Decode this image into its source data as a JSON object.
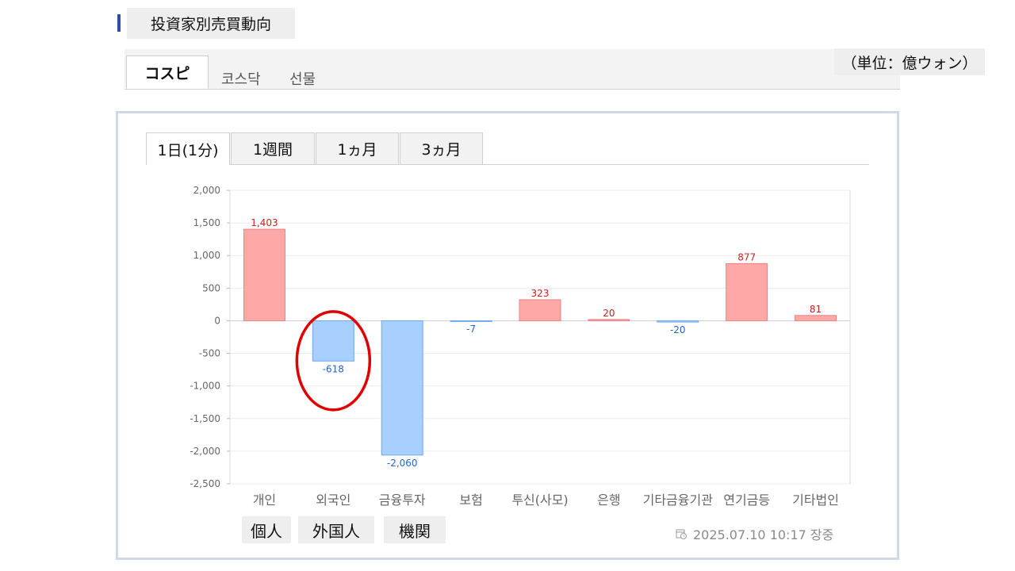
{
  "header": {
    "title": "投資家別売買動向"
  },
  "market_tabs": [
    {
      "label": "コスピ",
      "active": true
    },
    {
      "label": "코스닥",
      "active": false
    },
    {
      "label": "선물",
      "active": false
    }
  ],
  "unit_label": "（単位：億ウォン）",
  "period_tabs": [
    {
      "label": "1日(1分)",
      "active": true
    },
    {
      "label": "1週間",
      "active": false
    },
    {
      "label": "1ヵ月",
      "active": false
    },
    {
      "label": "3ヵ月",
      "active": false
    }
  ],
  "note_labels": [
    "個人",
    "外国人",
    "機関"
  ],
  "timestamp": "2025.07.10 10:17 장중",
  "colors": {
    "positive": "#ffa8a8",
    "positive_stroke": "#f08080",
    "negative": "#a8d0ff",
    "negative_stroke": "#6fa8f0",
    "annotation": "#e00000"
  },
  "chart_data": {
    "type": "bar",
    "categories": [
      "개인",
      "외국인",
      "금융투자",
      "보험",
      "투신(사모)",
      "은행",
      "기타금융",
      "기관",
      "연기금등",
      "기타법인"
    ],
    "category_labels": [
      "개인",
      "외국인",
      "금융투자",
      "보험",
      "투신(사모)",
      "은행",
      "기타금융기관",
      "연기금등",
      "기타법인"
    ],
    "values": [
      1403,
      -618,
      -2060,
      -7,
      323,
      20,
      -20,
      877,
      81
    ],
    "value_labels": [
      "1,403",
      "-618",
      "-2,060",
      "-7",
      "323",
      "20",
      "-20",
      "877",
      "81"
    ],
    "yticks": [
      "2,000",
      "1,500",
      "1,000",
      "500",
      "0",
      "-500",
      "-1,000",
      "-1,500",
      "-2,000",
      "-2,500"
    ],
    "ylim": [
      -2500,
      2000
    ],
    "grid": true,
    "highlight": "외국인"
  }
}
